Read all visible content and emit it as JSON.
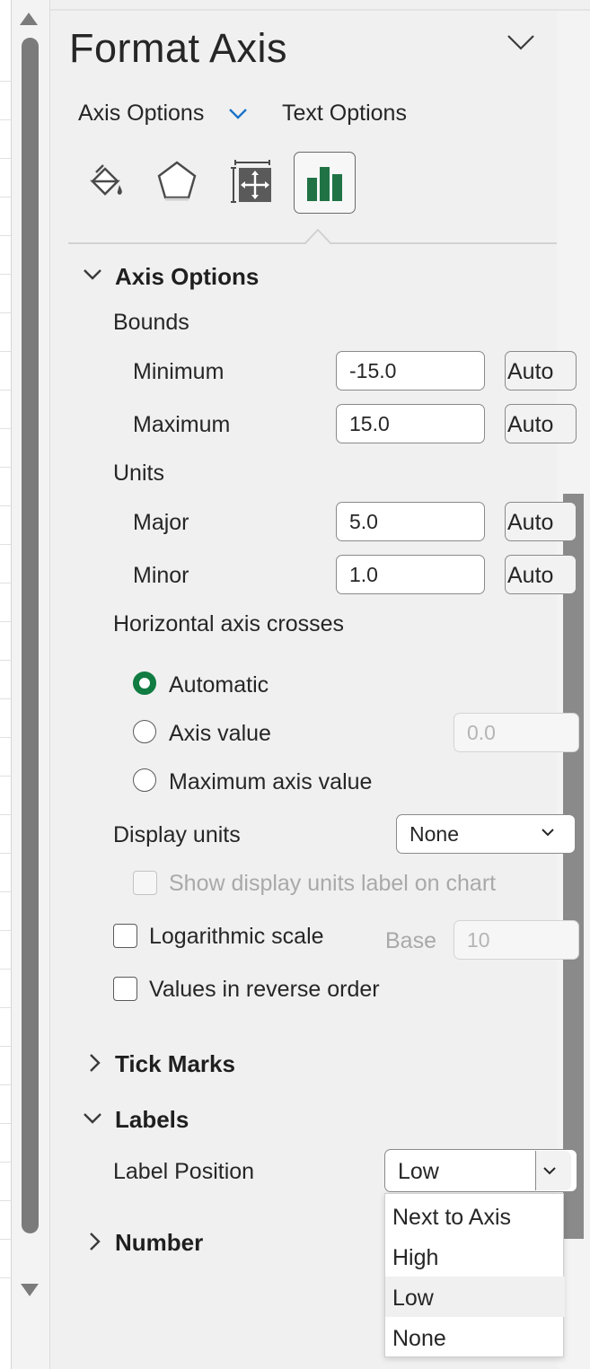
{
  "pane": {
    "title": "Format Axis"
  },
  "tabs": {
    "axis_options": "Axis Options",
    "text_options": "Text Options"
  },
  "icons": {
    "fill_line": "paint-bucket-icon",
    "effects": "pentagon-icon",
    "size_properties": "size-properties-icon",
    "axis_options": "bar-chart-icon",
    "accent_color": "#217346"
  },
  "axis_options": {
    "section_title": "Axis Options",
    "bounds": {
      "label": "Bounds",
      "minimum": {
        "label": "Minimum",
        "value": "-15.0",
        "auto_label": "Auto"
      },
      "maximum": {
        "label": "Maximum",
        "value": "15.0",
        "auto_label": "Auto"
      }
    },
    "units": {
      "label": "Units",
      "major": {
        "label": "Major",
        "value": "5.0",
        "auto_label": "Auto"
      },
      "minor": {
        "label": "Minor",
        "value": "1.0",
        "auto_label": "Auto"
      }
    },
    "axis_crosses": {
      "label": "Horizontal axis crosses",
      "automatic": {
        "label": "Automatic",
        "checked": true
      },
      "axis_value": {
        "label": "Axis value",
        "value": "0.0"
      },
      "maximum_axis_value": {
        "label": "Maximum axis value"
      }
    },
    "display_units": {
      "label": "Display units",
      "value": "None",
      "show_label": "Show display units label on chart"
    },
    "logarithmic": {
      "label": "Logarithmic scale",
      "base_label": "Base",
      "base_value": "10"
    },
    "reverse_order": {
      "label": "Values in reverse order"
    }
  },
  "tick_marks": {
    "section_title": "Tick Marks"
  },
  "labels": {
    "section_title": "Labels",
    "label_position": {
      "label": "Label Position",
      "value": "Low",
      "options": [
        "Next to Axis",
        "High",
        "Low",
        "None"
      ]
    }
  },
  "number": {
    "section_title": "Number"
  }
}
